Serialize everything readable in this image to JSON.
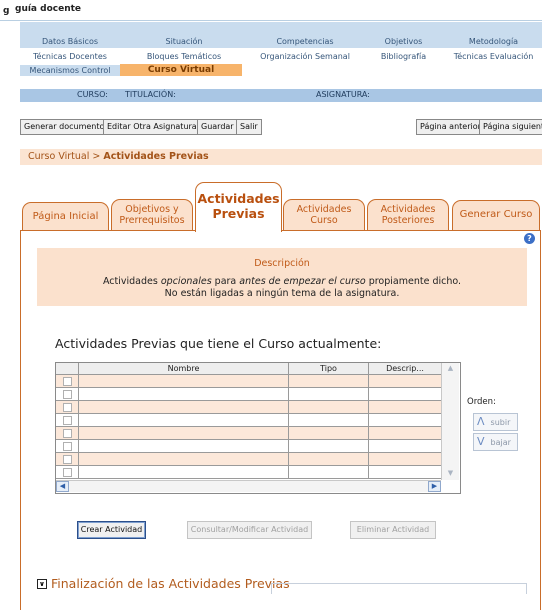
{
  "app": {
    "title": "guía docente",
    "logo_glyph": "g"
  },
  "nav": {
    "rows": [
      [
        "Datos Básicos",
        "Situación",
        "Competencias",
        "Objetivos",
        "Metodología"
      ],
      [
        "Técnicas Docentes",
        "Bloques Temáticos",
        "Organización Semanal",
        "Bibliografía",
        "Técnicas Evaluación"
      ],
      [
        "Mecanismos Control",
        "Curso Virtual"
      ]
    ],
    "active": "Curso Virtual"
  },
  "info": {
    "curso": "CURSO:",
    "titulacion": "TITULACIÓN:",
    "asignatura": "ASIGNATURA:"
  },
  "toolbar": {
    "generar": "Generar documento",
    "editar": "Editar Otra Asignatura",
    "guardar": "Guardar",
    "salir": "Salir",
    "anterior": "Página anterior",
    "siguiente": "Página siguiente"
  },
  "breadcrumb": {
    "root": "Curso Virtual",
    "sep": " > ",
    "current": "Actividades Previas"
  },
  "tabs": [
    {
      "l1": "Página Inicial",
      "l2": ""
    },
    {
      "l1": "Objetivos y",
      "l2": "Prerrequisitos"
    },
    {
      "l1": "Actividades",
      "l2": "Previas"
    },
    {
      "l1": "Actividades",
      "l2": "Curso"
    },
    {
      "l1": "Actividades",
      "l2": "Posteriores"
    },
    {
      "l1": "Generar Curso",
      "l2": ""
    }
  ],
  "active_tab": 2,
  "description": {
    "title": "Descripción",
    "p1_a": "Actividades ",
    "p1_em1": "opcionales",
    "p1_b": " para ",
    "p1_em2": "antes de empezar el curso",
    "p1_c": " propiamente dicho.",
    "p2": "No están ligadas a ningún tema de la asignatura."
  },
  "activities": {
    "title": "Actividades Previas que tiene el Curso actualmente:",
    "columns": [
      "Nombre",
      "Tipo",
      "Descrip..."
    ],
    "rows": [
      [
        "",
        "",
        ""
      ],
      [
        "",
        "",
        ""
      ],
      [
        "",
        "",
        ""
      ],
      [
        "",
        "",
        ""
      ],
      [
        "",
        "",
        ""
      ],
      [
        "",
        "",
        ""
      ],
      [
        "",
        "",
        ""
      ],
      [
        "",
        "",
        ""
      ]
    ]
  },
  "order": {
    "label": "Orden:",
    "up": "subir",
    "down": "bajar"
  },
  "actions": {
    "create": "Crear Actividad",
    "modify": "Consultar/Modificar Actividad",
    "delete": "Eliminar Actividad"
  },
  "final_section": {
    "title": "Finalización de las Actividades Previas"
  },
  "colors": {
    "nav_bg": "#c9dcee",
    "active_accent": "#f7b46b",
    "tab_border": "#c96d2a",
    "tab_text": "#c05a18",
    "peach_bg": "#fbe1cd"
  }
}
